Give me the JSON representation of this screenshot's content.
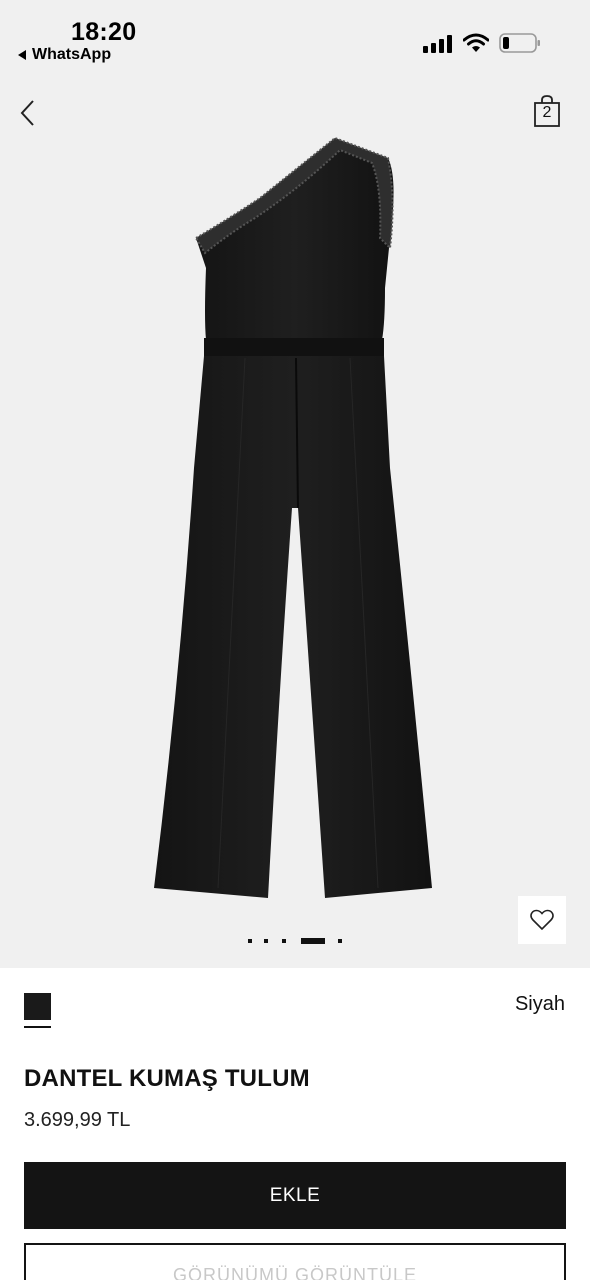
{
  "status_bar": {
    "time": "18:20",
    "back_app_label": "WhatsApp",
    "icons": [
      "signal-icon",
      "wifi-icon",
      "battery-icon"
    ]
  },
  "nav": {
    "back_icon": "chevron-left-icon",
    "bag_icon": "shopping-bag-icon",
    "bag_count": "2"
  },
  "gallery": {
    "favorite_icon": "heart-icon",
    "page_count": 5,
    "active_page": 4
  },
  "product": {
    "color_swatch": "#1a1a1a",
    "color_name": "Siyah",
    "title": "DANTEL KUMAŞ TULUM",
    "price": "3.699,99 TL"
  },
  "actions": {
    "add_label": "EKLE",
    "view_label": "GÖRÜNÜMÜ GÖRÜNTÜLE"
  },
  "colors": {
    "hero_background": "#f0f0f0",
    "primary": "#141414"
  }
}
